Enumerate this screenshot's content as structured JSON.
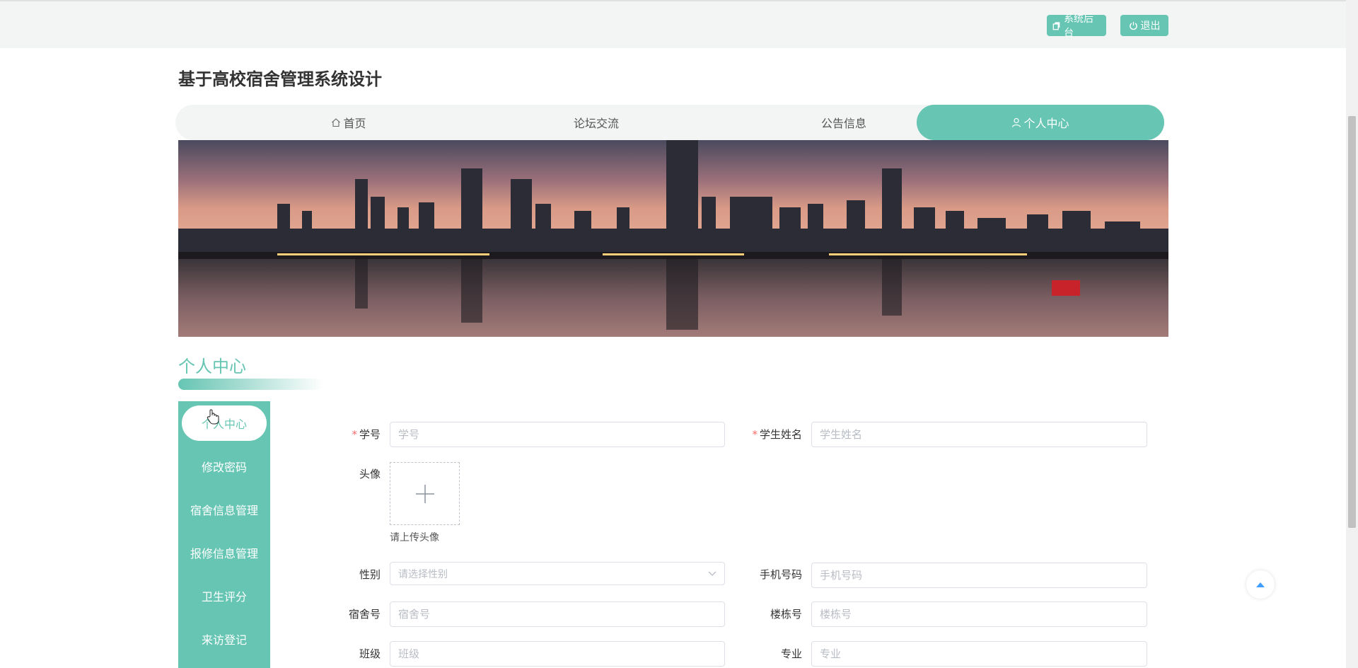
{
  "header": {
    "admin_button": "系统后台",
    "logout_button": "退出"
  },
  "site": {
    "title": "基于高校宿舍管理系统设计"
  },
  "nav": {
    "items": [
      {
        "label": "首页",
        "icon": "home-icon"
      },
      {
        "label": "论坛交流"
      },
      {
        "label": "公告信息"
      },
      {
        "label": "个人中心",
        "icon": "user-icon",
        "active": true
      }
    ]
  },
  "section": {
    "title": "个人中心"
  },
  "sidebar": {
    "items": [
      {
        "label": "个人中心",
        "active": true
      },
      {
        "label": "修改密码"
      },
      {
        "label": "宿舍信息管理"
      },
      {
        "label": "报修信息管理"
      },
      {
        "label": "卫生评分"
      },
      {
        "label": "来访登记"
      }
    ]
  },
  "form": {
    "student_id": {
      "label": "学号",
      "placeholder": "学号",
      "required": true
    },
    "student_name": {
      "label": "学生姓名",
      "placeholder": "学生姓名",
      "required": true
    },
    "avatar": {
      "label": "头像",
      "tip": "请上传头像"
    },
    "gender": {
      "label": "性别",
      "placeholder": "请选择性别"
    },
    "phone": {
      "label": "手机号码",
      "placeholder": "手机号码"
    },
    "dorm_no": {
      "label": "宿舍号",
      "placeholder": "宿舍号"
    },
    "building_no": {
      "label": "楼栋号",
      "placeholder": "楼栋号"
    },
    "class": {
      "label": "班级",
      "placeholder": "班级"
    },
    "major": {
      "label": "专业",
      "placeholder": "专业"
    }
  },
  "colors": {
    "accent": "#66c5b3",
    "required": "#f56c6c"
  }
}
